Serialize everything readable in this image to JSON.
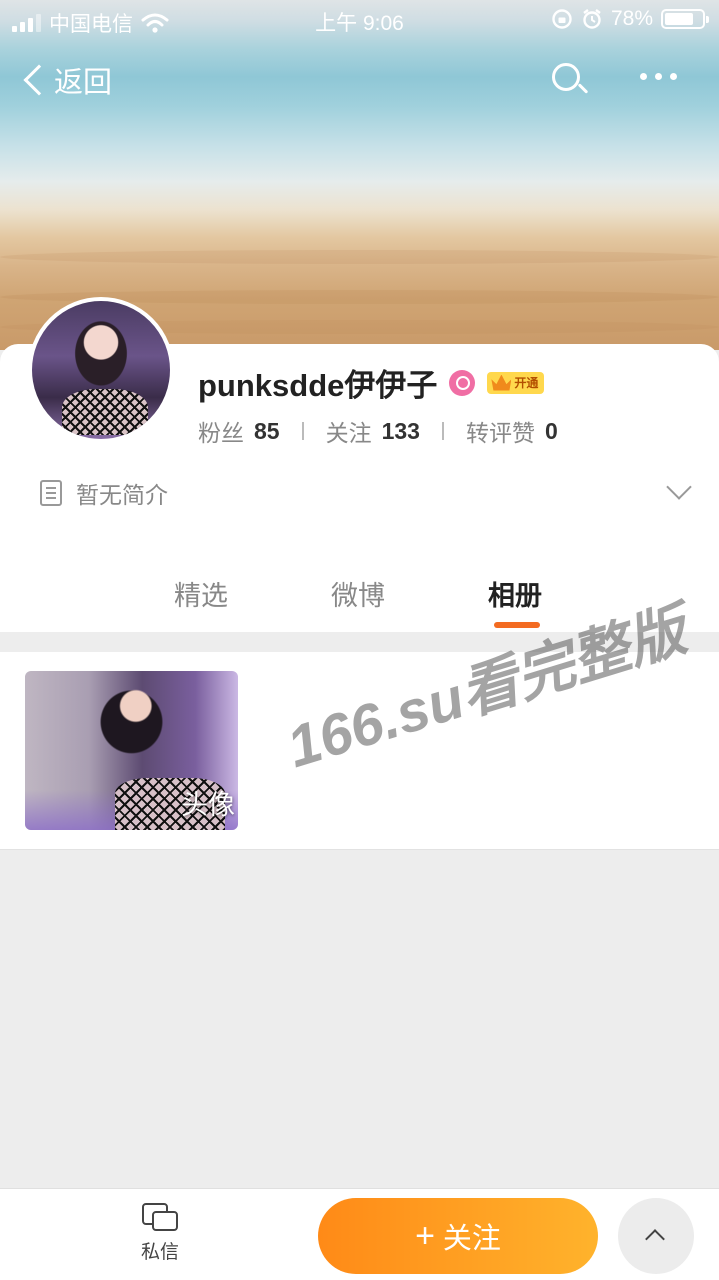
{
  "status_bar": {
    "carrier": "中国电信",
    "time": "上午 9:06",
    "battery": "78%",
    "battery_level": 0.78
  },
  "nav": {
    "back_label": "返回"
  },
  "profile": {
    "name": "punksdde伊伊子",
    "member_badge": "开通",
    "stats": [
      {
        "label": "粉丝",
        "value": "85"
      },
      {
        "label": "关注",
        "value": "133"
      },
      {
        "label": "转评赞",
        "value": "0"
      }
    ],
    "intro": "暂无简介"
  },
  "tabs": [
    {
      "label": "精选",
      "active": false
    },
    {
      "label": "微博",
      "active": false
    },
    {
      "label": "相册",
      "active": true
    }
  ],
  "album": {
    "items": [
      {
        "label": "头像"
      }
    ]
  },
  "watermark": "166.su看完整版",
  "bottom_bar": {
    "dm_label": "私信",
    "follow_label": "关注",
    "follow_icon": "+"
  },
  "colors": {
    "accent": "#f36b21",
    "follow_gradient_start": "#ff8a17",
    "follow_gradient_end": "#ffb32c",
    "vip_pink": "#f06ea4",
    "member_yellow": "#ffd84d"
  },
  "icons": {
    "search": "search-icon",
    "more": "more-icon",
    "back": "chevron-left-icon",
    "intro": "document-icon",
    "expand": "chevron-down-icon",
    "dm": "message-icon",
    "top": "chevron-up-icon"
  }
}
